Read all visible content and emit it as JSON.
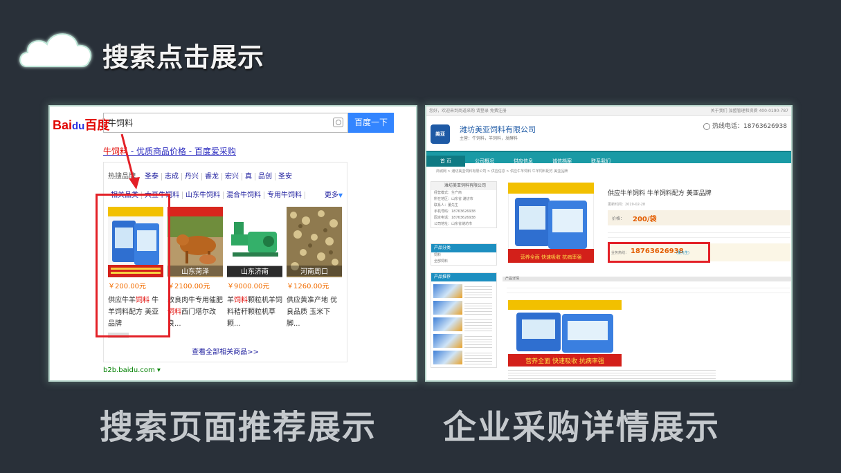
{
  "header": {
    "title": "搜索点击展示",
    "icon": "cloud-icon"
  },
  "captions": {
    "left": "搜索页面推荐展示",
    "right": "企业采购详情展示"
  },
  "baidu": {
    "logo_text": "Bai",
    "logo_paw": "du",
    "logo_cn": "百度",
    "query": "牛饲料",
    "search_button": "百度一下",
    "result_title_kw": "牛饲料",
    "result_title_rest": " - 优质商品价格 - 百度爱采购",
    "hot_label": "热搜品牌",
    "hot_brands": [
      "圣泰",
      "志成",
      "丹兴",
      "睿龙",
      "宏兴",
      "真",
      "品创",
      "圣安"
    ],
    "related_label": "相关品类",
    "related": [
      "大豆牛饲料",
      "山东牛饲料",
      "混合牛饲料",
      "专用牛饲料"
    ],
    "more": "更多",
    "products": [
      {
        "price": "￥200.00元",
        "name_a": "供应牛羊",
        "name_kw": "饲料",
        "name_b": " 牛羊饲料配方 美亚品牌",
        "thumb_label": ""
      },
      {
        "price": "￥2100.00元",
        "name_a": "改良肉牛专用催肥",
        "name_kw": "饲料",
        "name_b": "西门塔尔改良...",
        "thumb_label": "山东菏泽"
      },
      {
        "price": "￥9000.00元",
        "name_a": "羊",
        "name_kw": "饲料",
        "name_b": "颗粒机羊饲料秸秆颗粒机草颗...",
        "thumb_label": "山东济南"
      },
      {
        "price": "￥1260.00元",
        "name_a": "供应黄准产地 优良品质 玉米下脚...",
        "name_kw": "",
        "name_b": "",
        "thumb_label": "河南周口"
      }
    ],
    "view_all": "查看全部相关商品>>",
    "site_url": "b2b.baidu.com"
  },
  "company": {
    "topbar_left": "您好，欢迎来到商道采购   请登录   免费注册",
    "topbar_right": "关于我们  加盟管理和资质  400-0190-787",
    "logo": "美亚",
    "name": "潍坊美亚饲料有限公司",
    "sub": "主营：牛饲料，羊饲料，发酵料",
    "hotline": "热线电话：18763626938",
    "nav": [
      "首 页",
      "公司概况",
      "供应信息",
      "诚信档案",
      "联系我们"
    ],
    "crumb": "商城网  >  潍坊美亚饲料有限公司  >  供应信息  >  供应牛羊饲料 牛羊饲料配方 美亚品牌",
    "side_company": "潍坊美亚饲料有限公司",
    "side_lines": [
      "经营模式：生产商",
      "所在地区：山东省 潍坊市",
      "联系人：董先生",
      "手机号码：18763626938",
      "固定电话：18763626938",
      "公司地址：山东省潍坊市"
    ],
    "side_category": "产品分类",
    "side_categories": [
      "饲料",
      "全部饲料"
    ],
    "side_products": "产品推荐",
    "product_title": "供应牛羊饲料 牛羊饲料配方 美亚品牌",
    "release": "更新时间：2019-02-28",
    "price_label": "价格：",
    "price": "200/袋",
    "contact_label": "业务热线：",
    "contact_phone": "18763626938",
    "contact_person": "(董先生)",
    "desc_title": "产品详情",
    "poster_headline": "营养全面  快速吸收  抗病率强"
  }
}
